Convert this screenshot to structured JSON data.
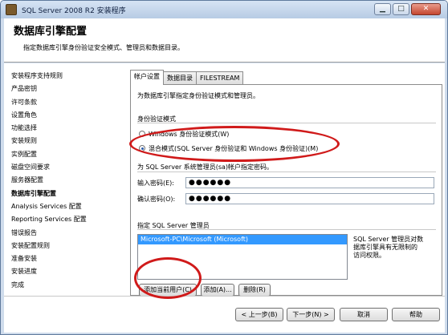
{
  "window": {
    "title": "SQL Server 2008 R2 安装程序",
    "minimize_glyph": "▁",
    "maximize_glyph": "□",
    "close_glyph": "✕"
  },
  "header": {
    "title": "数据库引擎配置",
    "subtitle": "指定数据库引擎身份验证安全模式、管理员和数据目录。"
  },
  "sidebar": {
    "items": [
      "安装程序支持规则",
      "产品密钥",
      "许可条款",
      "设置角色",
      "功能选择",
      "安装规则",
      "实例配置",
      "磁盘空间要求",
      "服务器配置",
      "数据库引擎配置",
      "Analysis Services 配置",
      "Reporting Services 配置",
      "错误报告",
      "安装配置规则",
      "准备安装",
      "安装进度",
      "完成"
    ],
    "active_index": 9
  },
  "tabs": [
    "帐户设置",
    "数据目录",
    "FILESTREAM"
  ],
  "account": {
    "intro": "为数据库引擎指定身份验证模式和管理员。",
    "auth_heading": "身份验证模式",
    "radio_windows": "Windows 身份验证模式(W)",
    "radio_mixed": "混合模式(SQL Server 身份验证和 Windows 身份验证)(M)",
    "sa_note": "为 SQL Server 系统管理员(sa)帐户指定密码。",
    "password_label": "输入密码(E):",
    "password_value": "●●●●●●",
    "confirm_label": "确认密码(O):",
    "confirm_value": "●●●●●●",
    "admins_heading": "指定 SQL Server 管理员",
    "admins": [
      "Microsoft-PC\\Microsoft (Microsoft)"
    ],
    "admins_note_line1": "SQL Server 管理员对数",
    "admins_note_line2": "据库引擎具有无限制的",
    "admins_note_line3": "访问权限。",
    "add_current_user": "添加当前用户(C)",
    "add": "添加(A)...",
    "remove": "删除(R)"
  },
  "footer": {
    "back": "< 上一步(B)",
    "next": "下一步(N) >",
    "cancel": "取消",
    "help": "帮助"
  },
  "colors": {
    "highlight": "#3399ff",
    "annotation": "#d01a1a",
    "titlebar": "#c4d6ee"
  }
}
